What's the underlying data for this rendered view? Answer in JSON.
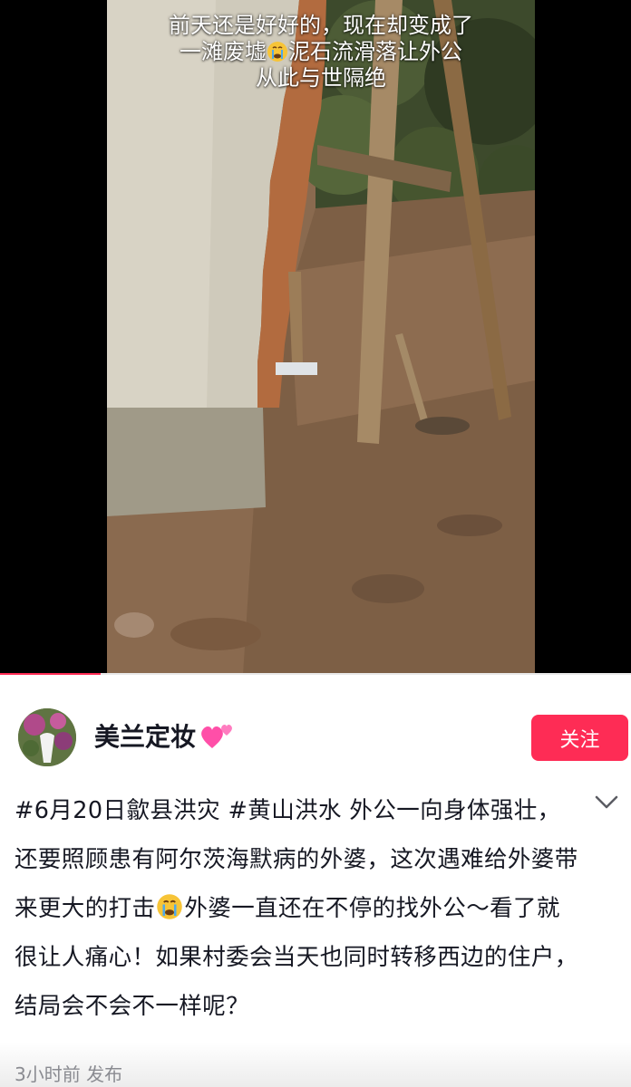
{
  "video": {
    "caption_line1": "前天还是好好的，现在却变成了",
    "caption_line2a": "一滩废墟",
    "caption_line2b": "泥石流滑落让外公",
    "caption_line3": "从此与世隔绝",
    "caption_emoji": "crying-face-icon",
    "progress": 0.16
  },
  "author": {
    "name": "美兰定妆",
    "name_emoji": "two-hearts-icon",
    "follow_label": "关注"
  },
  "description": {
    "part1": "#6月20日歙县洪灾 #黄山洪水 外公一向身体强壮，还要照顾患有阿尔茨海默病的外婆，这次遇难给外婆带来更大的打击",
    "emoji": "crying-face-icon",
    "part2": "外婆一直还在不停的找外公～看了就很让人痛心！如果村委会当天也同时转移西边的住户，结局会不会不一样呢？",
    "expand_icon": "chevron-down-icon"
  },
  "meta": {
    "time_text": "3小时前 发布"
  },
  "colors": {
    "accent": "#fe2c55",
    "text": "#161823",
    "muted": "#8a8b91"
  }
}
